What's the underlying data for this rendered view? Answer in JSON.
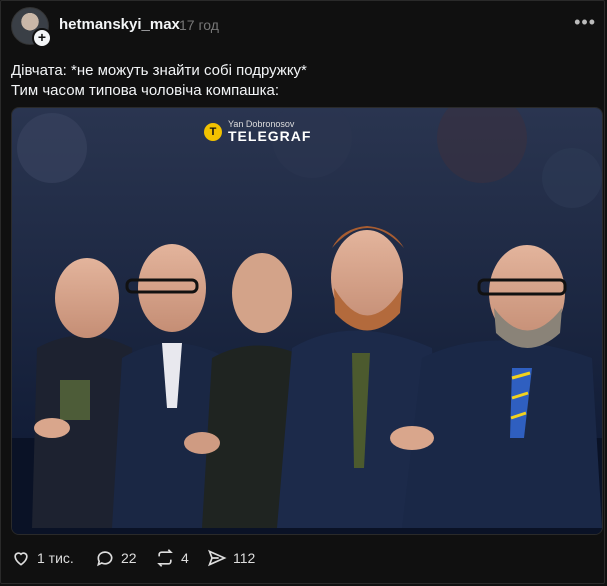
{
  "post": {
    "username": "hetmanskyi_max",
    "time": "17 год",
    "more_icon": "more-icon",
    "caption_line1": "Дівчата: *не можуть знайти собі подружку*",
    "caption_line2": "Тим часом типова чоловіча компашка:",
    "watermark_small": "Yan Dobronosov",
    "watermark_big": "TELEGRAF"
  },
  "actions": {
    "likes": "1 тис.",
    "comments": "22",
    "reposts": "4",
    "shares": "112"
  },
  "colors": {
    "background": "#101010",
    "text": "#f3f5f7",
    "muted": "#777777"
  }
}
